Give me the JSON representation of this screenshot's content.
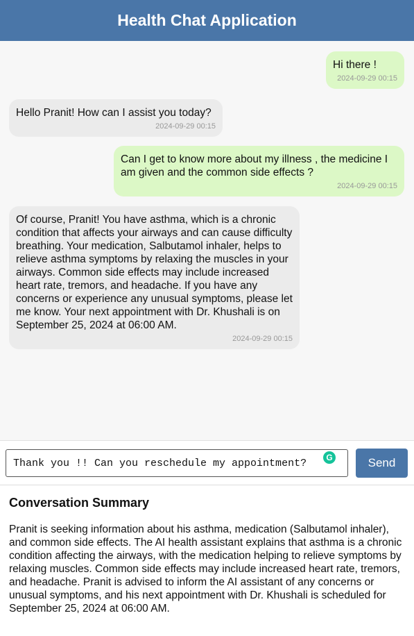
{
  "header": {
    "title": "Health Chat Application"
  },
  "messages": [
    {
      "sender": "user",
      "text": "Hi there !",
      "time": "2024-09-29 00:15"
    },
    {
      "sender": "bot",
      "text": "Hello Pranit! How can I assist you today?",
      "time": "2024-09-29 00:15"
    },
    {
      "sender": "user",
      "text": "Can I get to know more about my illness , the medicine I am given and the common side effects ?",
      "time": "2024-09-29 00:15"
    },
    {
      "sender": "bot",
      "text": "Of course, Pranit! You have asthma, which is a chronic condition that affects your airways and can cause difficulty breathing. Your medication, Salbutamol inhaler, helps to relieve asthma symptoms by relaxing the muscles in your airways. Common side effects may include increased heart rate, tremors, and headache. If you have any concerns or experience any unusual symptoms, please let me know. Your next appointment with Dr. Khushali is on September 25, 2024 at 06:00 AM.",
      "time": "2024-09-29 00:15"
    }
  ],
  "input": {
    "value": "Thank you !! Can you reschedule my appointment?"
  },
  "icons": {
    "grammarly": "grammarly-icon"
  },
  "send_label": "Send",
  "summary": {
    "heading": "Conversation Summary",
    "text": "Pranit is seeking information about his asthma, medication (Salbutamol inhaler), and common side effects. The AI health assistant explains that asthma is a chronic condition affecting the airways, with the medication helping to relieve symptoms by relaxing muscles. Common side effects may include increased heart rate, tremors, and headache. Pranit is advised to inform the AI assistant of any concerns or unusual symptoms, and his next appointment with Dr. Khushali is scheduled for September 25, 2024 at 06:00 AM."
  },
  "colors": {
    "header": "#4a76a8",
    "user_bubble": "#dcf8c6",
    "bot_bubble": "#ebebeb",
    "send_button": "#4a76a8"
  }
}
